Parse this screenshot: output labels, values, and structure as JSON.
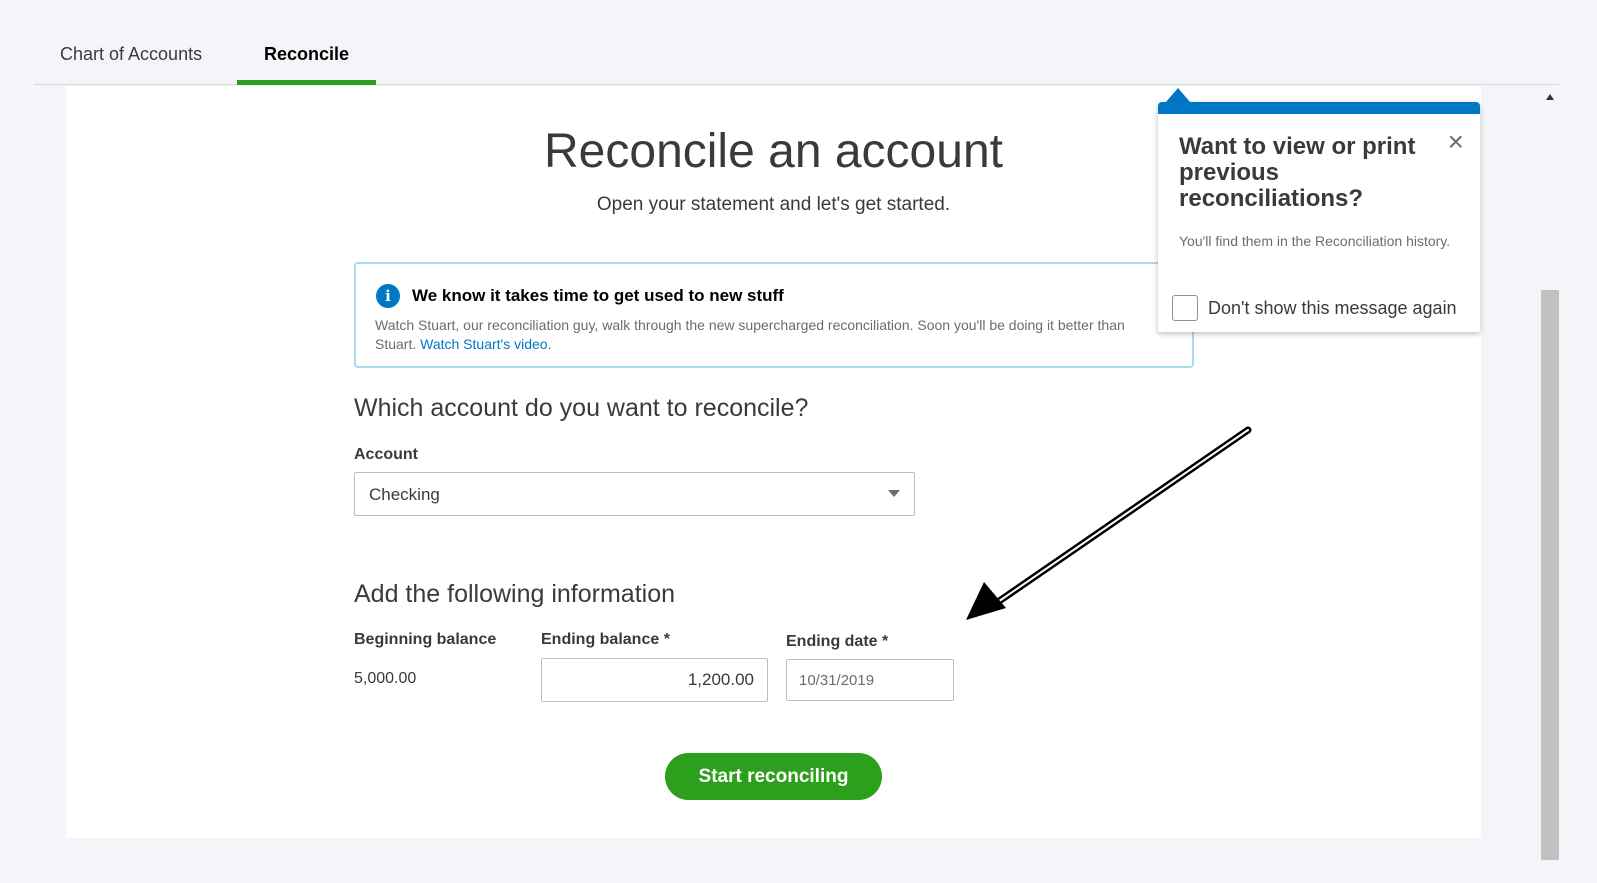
{
  "tabs": [
    {
      "label": "Chart of Accounts",
      "active": false
    },
    {
      "label": "Reconcile",
      "active": true
    }
  ],
  "page": {
    "title": "Reconcile an account",
    "subtitle": "Open your statement and let's get started."
  },
  "info_banner": {
    "title": "We know it takes time to get used to new stuff",
    "body": "Watch Stuart, our reconciliation guy, walk through the new supercharged reconciliation. Soon you'll be doing it better than Stuart.",
    "link_text": "Watch Stuart's video."
  },
  "account_section": {
    "heading": "Which account do you want to reconcile?",
    "account_label": "Account",
    "account_value": "Checking"
  },
  "info_section": {
    "heading": "Add the following information",
    "beginning_balance_label": "Beginning balance",
    "beginning_balance_value": "5,000.00",
    "ending_balance_label": "Ending balance *",
    "ending_balance_value": "1,200.00",
    "ending_date_label": "Ending date *",
    "ending_date_value": "10/31/2019"
  },
  "start_button": "Start reconciling",
  "popover": {
    "title": "Want to view or print previous reconciliations?",
    "body": "You'll find them in the Reconciliation history.",
    "checkbox_label": "Don't show this message again",
    "checked": false
  },
  "colors": {
    "accent_green": "#2ca01c",
    "accent_blue": "#0077c5",
    "info_border": "#a9dbef"
  }
}
